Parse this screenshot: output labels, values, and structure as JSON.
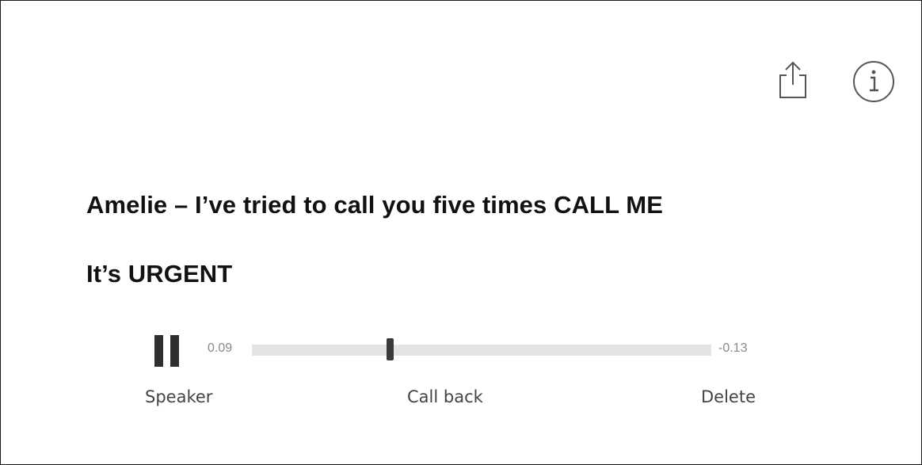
{
  "toolbar": {
    "share_icon": "share-icon",
    "info_icon": "info-icon"
  },
  "message": {
    "line1": "Amelie – I’ve tried to call you five times CALL ME",
    "line2": "It’s URGENT"
  },
  "player": {
    "state": "playing",
    "pause_icon": "pause-icon",
    "elapsed": "0.09",
    "remaining": "-0.13",
    "progress": 0.3
  },
  "actions": {
    "speaker": "Speaker",
    "call_back": "Call back",
    "delete": "Delete"
  },
  "colors": {
    "text": "#111111",
    "muted": "#8a8a8a",
    "track": "#e4e4e4",
    "thumb": "#3a3a3a"
  }
}
